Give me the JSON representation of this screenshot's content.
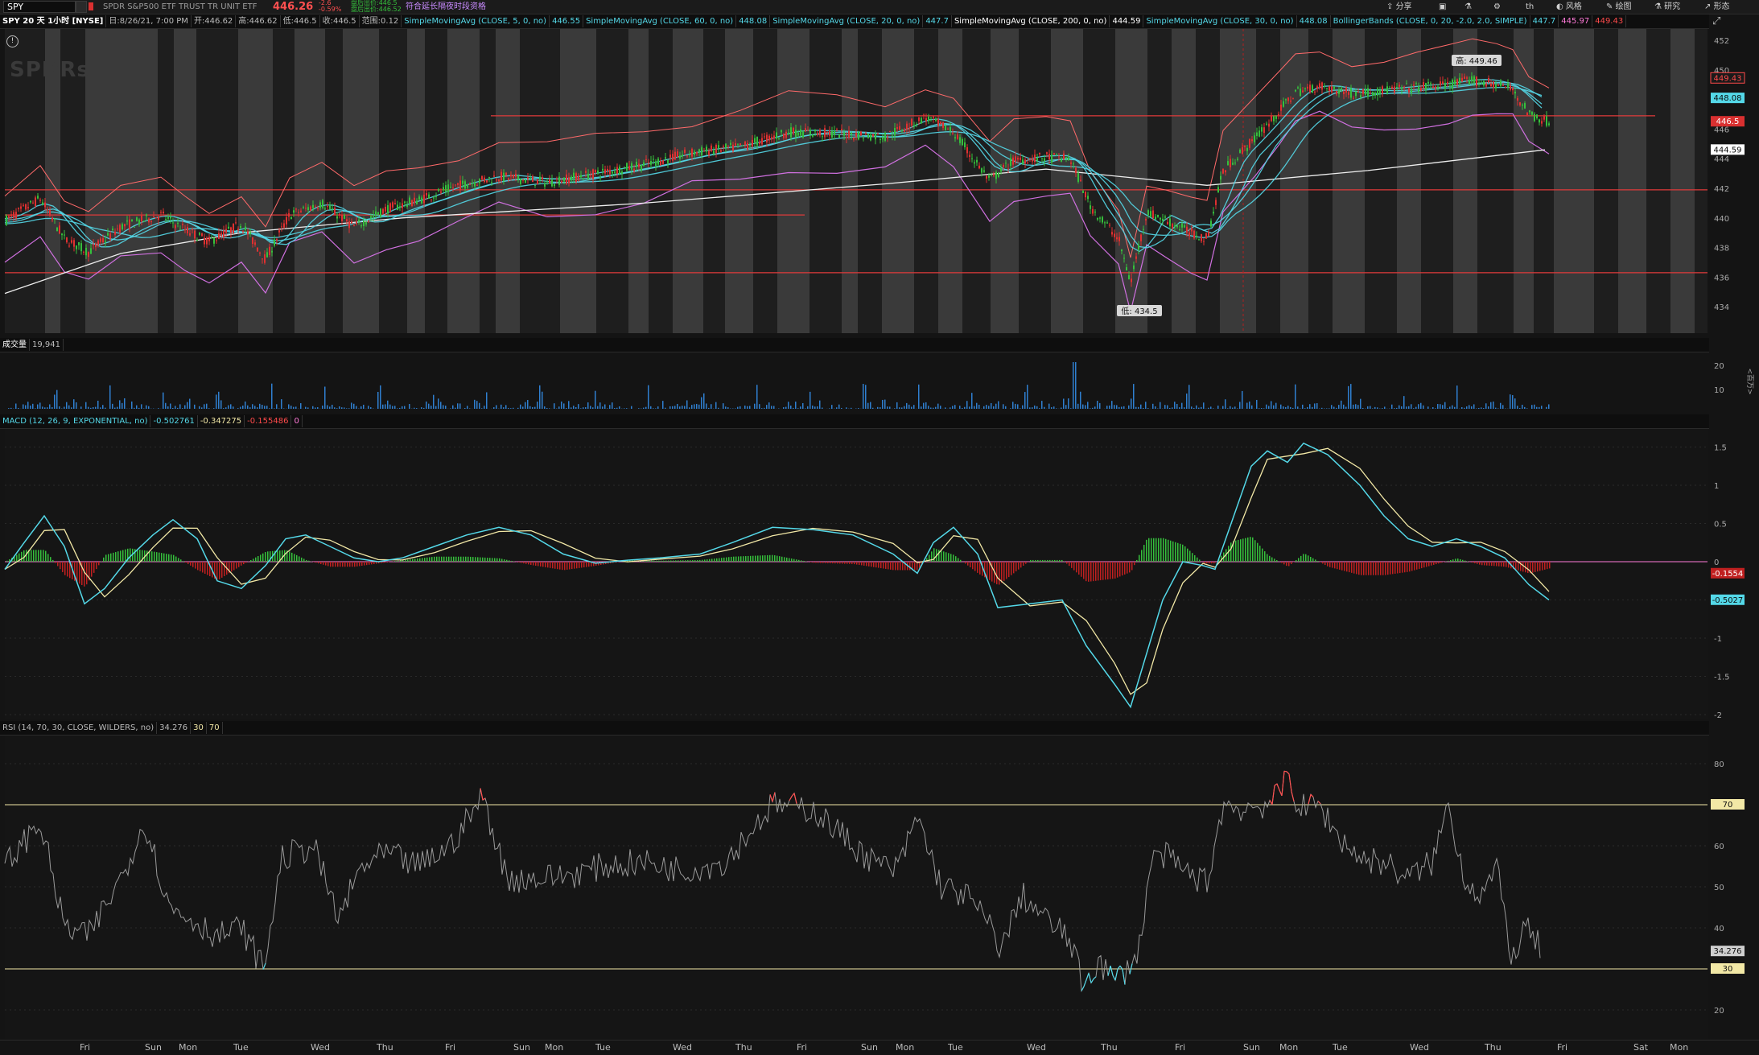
{
  "toolbar": {
    "symbol": "SPY",
    "company": "SPDR S&P500 ETF TRUST TR UNIT ETF",
    "last_price": "446.26",
    "change": "-2.6",
    "change_pct": "-0.59%",
    "bid_ask_1": "盘后出价:446.5",
    "bid_ask_2": "盘后出价:446.52",
    "ext_hours_note": "符合延长隔夜时段资格",
    "share": "分享",
    "th": "th",
    "style": "风格",
    "drawing": "绘图",
    "study": "研究",
    "pattern": "形态"
  },
  "price_info": {
    "title": "SPY 20 天 1小时 [NYSE]",
    "date": "日:8/26/21, 7:00 PM",
    "open": "开:446.62",
    "high": "高:446.62",
    "low": "低:446.5",
    "close": "收:446.5",
    "range": "范围:0.12",
    "studies": [
      {
        "label": "SimpleMovingAvg (CLOSE, 5, 0, no)",
        "value": "446.55"
      },
      {
        "label": "SimpleMovingAvg (CLOSE, 60, 0, no)",
        "value": "448.08"
      },
      {
        "label": "SimpleMovingAvg (CLOSE, 20, 0, no)",
        "value": "447.7"
      },
      {
        "label": "SimpleMovingAvg (CLOSE, 200, 0, no)",
        "value": "444.59"
      },
      {
        "label": "SimpleMovingAvg (CLOSE, 30, 0, no)",
        "value": "448.08"
      },
      {
        "label": "BollingerBands (CLOSE, 0, 20, -2.0, 2.0, SIMPLE)",
        "value": "447.7"
      },
      {
        "label": "",
        "value": "445.97"
      },
      {
        "label": "",
        "value": "449.43"
      }
    ],
    "watermark": "SPDRs",
    "high_bubble": "高: 449.46",
    "low_bubble": "低: 434.5",
    "y_ticks": [
      "452",
      "450",
      "448",
      "446",
      "444",
      "442",
      "440",
      "438",
      "436",
      "434"
    ],
    "tags": [
      {
        "text": "449.43",
        "color": "#ff4a4a",
        "bg": "#1a1a1a"
      },
      {
        "text": "448.08",
        "color": "#0d0d0d",
        "bg": "#54d8e8"
      },
      {
        "text": "446.5",
        "color": "#ffffff",
        "bg": "#d93030"
      },
      {
        "text": "444.59",
        "color": "#0d0d0d",
        "bg": "#ffffff"
      }
    ]
  },
  "volume": {
    "label": "成交量",
    "value": "19,941",
    "y_ticks": [
      "20",
      "10"
    ],
    "unit": "<百万>"
  },
  "macd": {
    "label": "MACD (12, 26, 9, EXPONENTIAL, no)",
    "value": "-0.502761",
    "avg": "-0.347275",
    "diff": "-0.155486",
    "zero": "0",
    "y_ticks": [
      "1.5",
      "1",
      "0.5",
      "0",
      "-0.5",
      "-1",
      "-1.5",
      "-2"
    ],
    "tags": [
      {
        "text": "-0.1554",
        "color": "#ffffff",
        "bg": "#c02020"
      },
      {
        "text": "-0.5027",
        "color": "#0d0d0d",
        "bg": "#54d8e8"
      }
    ]
  },
  "rsi": {
    "label": "RSI (14, 70, 30, CLOSE, WILDERS, no)",
    "value": "34.276",
    "ob": "30",
    "os": "70",
    "y_ticks": [
      "80",
      "70",
      "60",
      "50",
      "40",
      "30",
      "20"
    ],
    "tags": [
      {
        "text": "70",
        "color": "#0d0d0d",
        "bg": "#f2e8a6"
      },
      {
        "text": "34.276",
        "color": "#0d0d0d",
        "bg": "#cfcfcf"
      },
      {
        "text": "30",
        "color": "#0d0d0d",
        "bg": "#f2e8a6"
      }
    ]
  },
  "time_axis": [
    "Fri",
    "Sun",
    "Mon",
    "Tue",
    "Wed",
    "Thu",
    "Fri",
    "Sun",
    "Mon",
    "Tue",
    "Wed",
    "Thu",
    "Fri",
    "Sun",
    "Mon",
    "Tue",
    "Wed",
    "Thu",
    "Fri",
    "Sun",
    "Mon",
    "Tue",
    "Wed",
    "Thu",
    "Fri",
    "Sat",
    "Mon"
  ],
  "colors": {
    "cyan": "#54d8e8",
    "pink": "#ff7ad9",
    "red": "#ff4a4a",
    "yellow": "#f2e8a6",
    "green": "#35c03c",
    "white": "#eeeeee"
  }
}
